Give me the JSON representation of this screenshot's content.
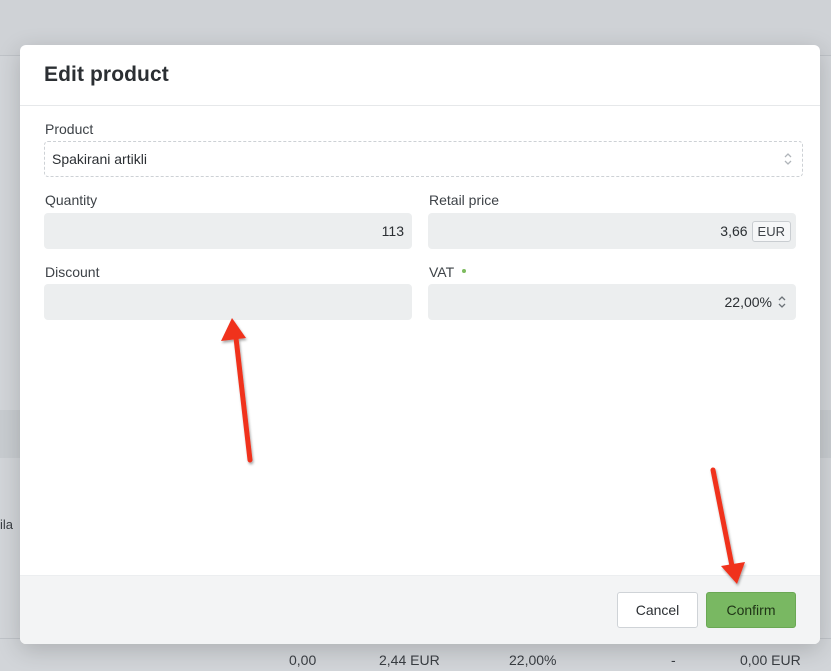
{
  "background": {
    "row_fragments": [
      "ila"
    ],
    "footer_row": [
      "0,00",
      "2,44 EUR",
      "22,00%",
      "-",
      "0,00 EUR"
    ]
  },
  "modal": {
    "title": "Edit product",
    "product": {
      "label": "Product",
      "value": "Spakirani artikli"
    },
    "quantity": {
      "label": "Quantity",
      "value": "113"
    },
    "retail_price": {
      "label": "Retail price",
      "value": "3,66",
      "currency": "EUR"
    },
    "discount": {
      "label": "Discount",
      "value": ""
    },
    "vat": {
      "label": "VAT",
      "value": "22,00%"
    },
    "buttons": {
      "cancel": "Cancel",
      "confirm": "Confirm"
    }
  },
  "colors": {
    "confirm_bg": "#79b862",
    "annotation_arrow": "#f0321e",
    "required_dot": "#7dbb5e"
  },
  "icons": [
    "stepper-icon",
    "annotation-arrow"
  ]
}
